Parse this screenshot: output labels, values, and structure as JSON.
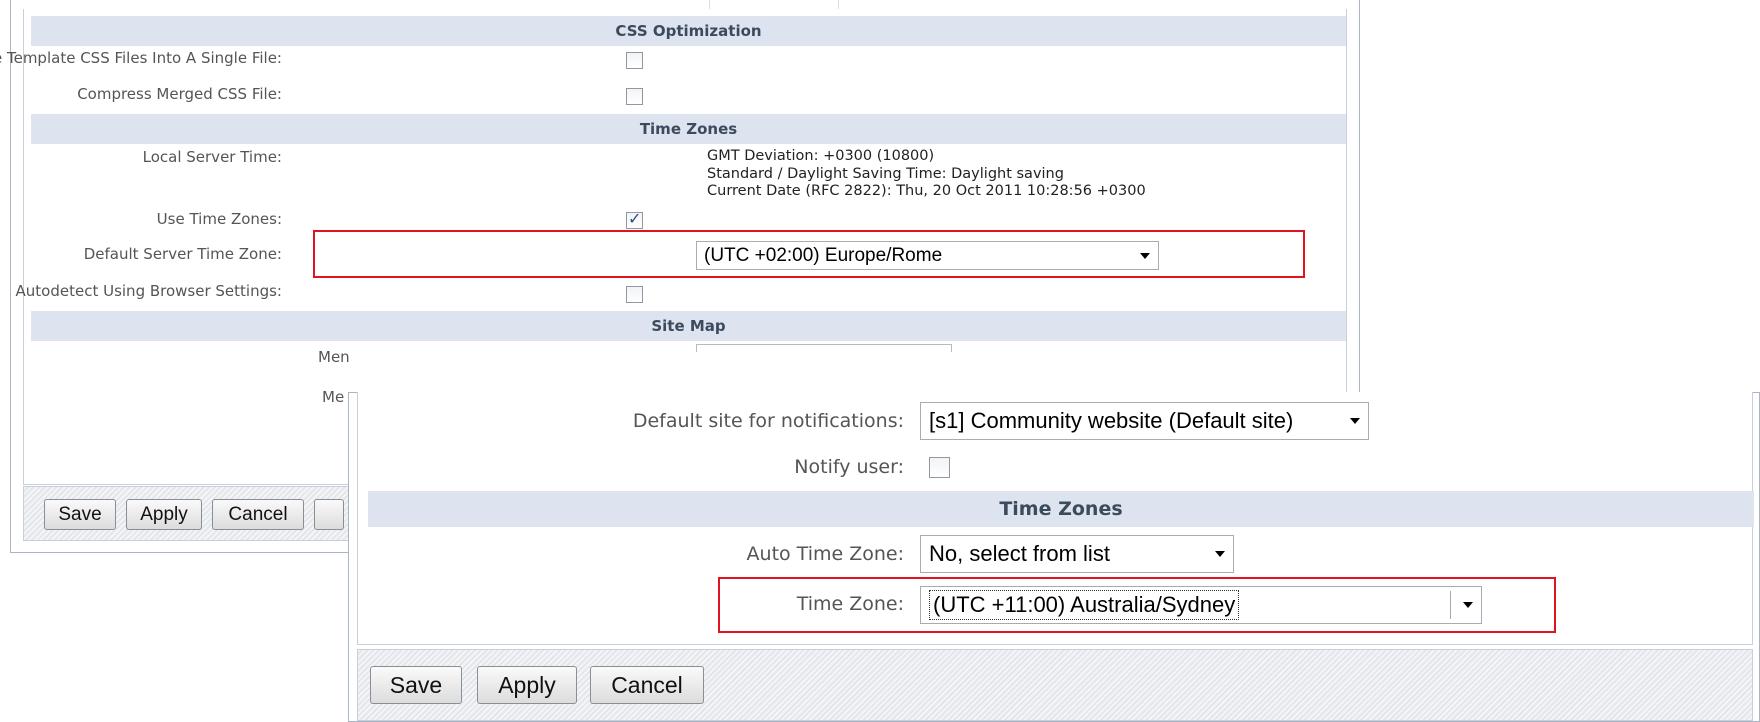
{
  "back_panel": {
    "sections": {
      "css": "CSS Optimization",
      "timezones": "Time Zones",
      "sitemap": "Site Map"
    },
    "css_fields": {
      "merge_label": "Merge Template CSS Files Into A Single File:",
      "merge_checked": false,
      "compress_label": "Compress Merged CSS File:",
      "compress_checked": false
    },
    "tz_fields": {
      "local_server_time_label": "Local Server Time:",
      "gmt_line": "GMT Deviation: +0300 (10800)",
      "dst_line": "Standard / Daylight Saving Time: Daylight saving",
      "date_line": "Current Date (RFC 2822): Thu, 20 Oct 2011 10:28:56 +0300",
      "use_tz_label": "Use Time Zones:",
      "use_tz_checked": true,
      "default_tz_label": "Default Server Time Zone:",
      "default_tz_value": "(UTC +02:00) Europe/Rome",
      "autodetect_label": "Autodetect Using Browser Settings:",
      "autodetect_checked": false
    },
    "sitemap_fields": {
      "partial_label_1": "Men",
      "partial_label_2": "Me"
    },
    "buttons": {
      "save": "Save",
      "apply": "Apply",
      "cancel": "Cancel"
    }
  },
  "front_panel": {
    "fields": {
      "default_site_label": "Default site for notifications:",
      "default_site_value": "[s1] Community website (Default site)",
      "notify_label": "Notify user:",
      "notify_checked": false
    },
    "section_title": "Time Zones",
    "tz_fields": {
      "auto_tz_label": "Auto Time Zone:",
      "auto_tz_value": "No, select from list",
      "tz_label": "Time Zone:",
      "tz_value": "(UTC +11:00) Australia/Sydney"
    },
    "buttons": {
      "save": "Save",
      "apply": "Apply",
      "cancel": "Cancel"
    }
  },
  "colors": {
    "section_header_bg": "#dde4ef",
    "highlight_border": "#e0141e"
  }
}
